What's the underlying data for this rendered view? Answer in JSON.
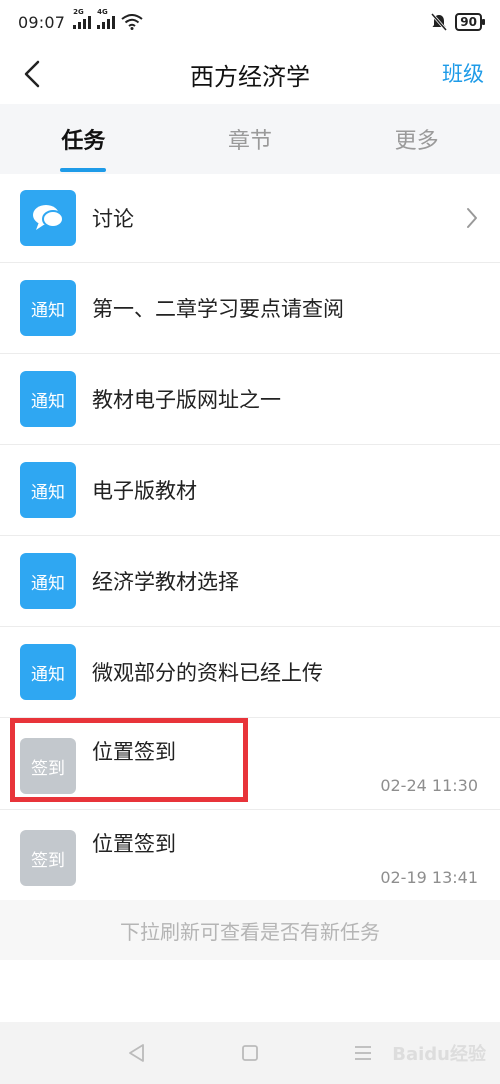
{
  "status_bar": {
    "time": "09:07",
    "sim1": "2G",
    "sim2": "4G",
    "battery": "90"
  },
  "nav": {
    "title": "西方经济学",
    "right_action": "班级"
  },
  "tabs": [
    {
      "label": "任务",
      "active": true
    },
    {
      "label": "章节",
      "active": false
    },
    {
      "label": "更多",
      "active": false
    }
  ],
  "list": {
    "discussion": {
      "label": "讨论",
      "icon": "chat-bubble-icon"
    },
    "notices": [
      {
        "badge": "通知",
        "title": "第一、二章学习要点请查阅"
      },
      {
        "badge": "通知",
        "title": "教材电子版网址之一"
      },
      {
        "badge": "通知",
        "title": "电子版教材"
      },
      {
        "badge": "通知",
        "title": "经济学教材选择"
      },
      {
        "badge": "通知",
        "title": "微观部分的资料已经上传"
      }
    ],
    "checkins": [
      {
        "badge": "签到",
        "title": "位置签到",
        "time": "02-24 11:30",
        "highlighted": true
      },
      {
        "badge": "签到",
        "title": "位置签到",
        "time": "02-19 13:41",
        "highlighted": false
      }
    ]
  },
  "refresh_hint": "下拉刷新可查看是否有新任务",
  "watermark": "Baidu经验",
  "colors": {
    "accent": "#1e9be8",
    "notice_badge": "#2fa7f2",
    "checkin_badge": "#c3c8cd",
    "highlight": "#e8343a"
  }
}
